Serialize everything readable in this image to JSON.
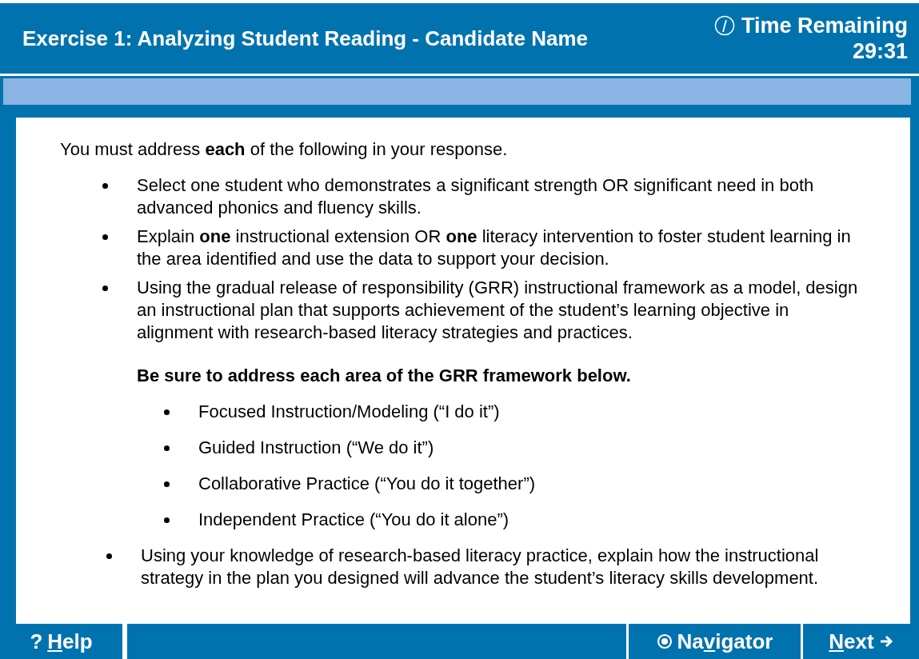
{
  "header": {
    "title": "Exercise 1: Analyzing Student Reading - Candidate Name",
    "timer_label": "Time Remaining",
    "timer_value": "29:31"
  },
  "content": {
    "intro": "You must address **each** of the following in your response.",
    "bullets": [
      {
        "text": "Select one student who demonstrates a significant strength OR significant need in both advanced phonics and fluency skills."
      },
      {
        "text": "Explain **one** instructional extension OR **one** literacy intervention to foster student learning in the area identified and use the data to support your decision."
      },
      {
        "text": "Using the gradual release of responsibility (GRR) instructional framework as a model, design an instructional plan that supports achievement of the student’s learning objective in alignment with research-based literacy strategies and practices."
      }
    ],
    "subheading": "Be sure to address each area of the GRR framework below.",
    "sub_bullets": [
      "Focused Instruction/Modeling (“I do it”)",
      "Guided Instruction (“We do it”)",
      "Collaborative Practice (“You do it together”)",
      "Independent Practice (“You do it alone”)"
    ],
    "final_bullet": "Using your knowledge of research-based literacy practice, explain how the instructional strategy in the plan you designed will advance the student’s literacy skills development."
  },
  "footer": {
    "buttons": [
      {
        "kind": "help",
        "icon_char": "?",
        "key": "H",
        "after": "elp"
      },
      {
        "kind": "navigator",
        "before": "Na",
        "key": "v",
        "after": "igator"
      },
      {
        "kind": "next",
        "key": "N",
        "after": "ext"
      }
    ]
  }
}
